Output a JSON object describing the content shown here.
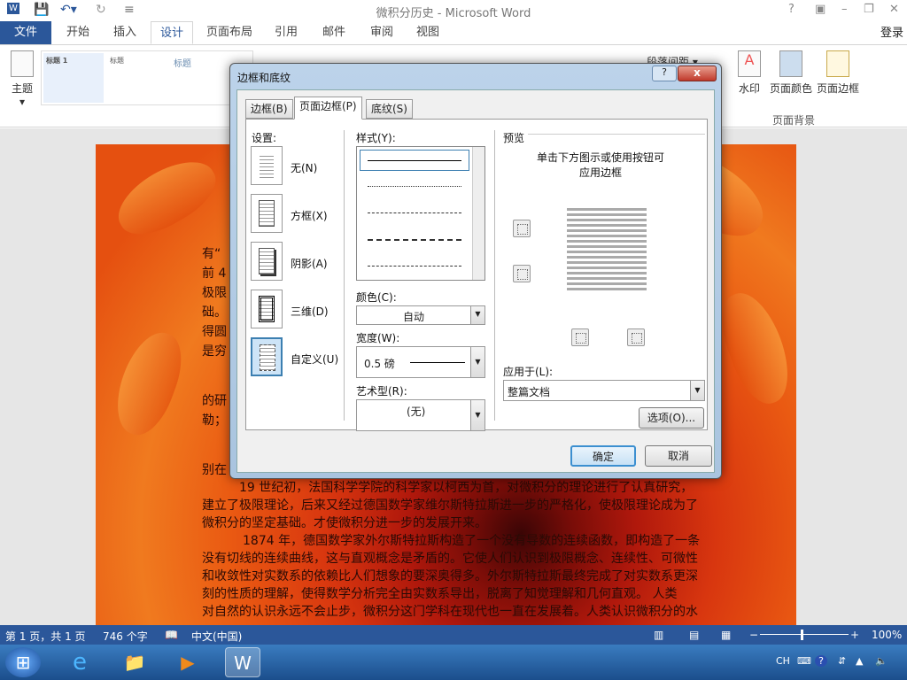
{
  "window": {
    "title": "微积分历史 - Microsoft Word",
    "help": "?",
    "login": "登录"
  },
  "tabs": [
    {
      "label": "文件"
    },
    {
      "label": "开始"
    },
    {
      "label": "插入"
    },
    {
      "label": "设计"
    },
    {
      "label": "页面布局"
    },
    {
      "label": "引用"
    },
    {
      "label": "邮件"
    },
    {
      "label": "审阅"
    },
    {
      "label": "视图"
    }
  ],
  "ribbon": {
    "theme": "主题",
    "gallery": [
      "标题",
      "标题 1",
      "标题"
    ],
    "paragraph_spacing": "段落间距",
    "watermark": "水印",
    "page_color": "页面颜色",
    "page_border": "页面边框",
    "group_page_background": "页面背景"
  },
  "document": {
    "left_fragments": [
      "有“",
      "前 4",
      "极限",
      "础。",
      "得圆",
      "是穷",
      "的研",
      "勒；",
      "别在"
    ],
    "lines": [
      "19 世纪初，法国科学学院的科学家以柯西为首，对微积分的理论进行了认真研究，",
      "建立了极限理论，后来又经过德国数学家维尔斯特拉斯进一步的严格化，使极限理论成为了",
      "微积分的坚定基础。才使微积分进一步的发展开来。",
      "1874 年，德国数学家外尔斯特拉斯构造了一个没有导数的连续函数，即构造了一条",
      "没有切线的连续曲线，这与直观概念是矛盾的。它使人们认识到极限概念、连续性、可微性",
      "和收敛性对实数系的依赖比人们想象的要深奥得多。外尔斯特拉斯最终完成了对实数系更深",
      "刻的性质的理解，使得数学分析完全由实数系导出，脱离了知觉理解和几何直观。  人类",
      "对自然的认识永远不会止步，微积分这门学科在现代也一直在发展着。人类认识微积分的水"
    ]
  },
  "dialog": {
    "title": "边框和底纹",
    "help": "?",
    "close": "x",
    "tabs": [
      "边框(B)",
      "页面边框(P)",
      "底纹(S)"
    ],
    "settings_label": "设置:",
    "settings": [
      "无(N)",
      "方框(X)",
      "阴影(A)",
      "三维(D)",
      "自定义(U)"
    ],
    "style_label": "样式(Y):",
    "color_label": "颜色(C):",
    "color_value": "自动",
    "width_label": "宽度(W):",
    "width_value": "0.5 磅",
    "art_label": "艺术型(R):",
    "art_value": "(无)",
    "preview_label": "预览",
    "preview_hint": "单击下方图示或使用按钮可\n应用边框",
    "apply_label": "应用于(L):",
    "apply_value": "整篇文档",
    "options": "选项(O)...",
    "ok": "确定",
    "cancel": "取消"
  },
  "status": {
    "page": "第 1 页，共 1 页",
    "words": "746 个字",
    "language": "中文(中国)",
    "zoom": "100%",
    "zoom_percent": 100
  },
  "tray": {
    "ime": "CH"
  }
}
